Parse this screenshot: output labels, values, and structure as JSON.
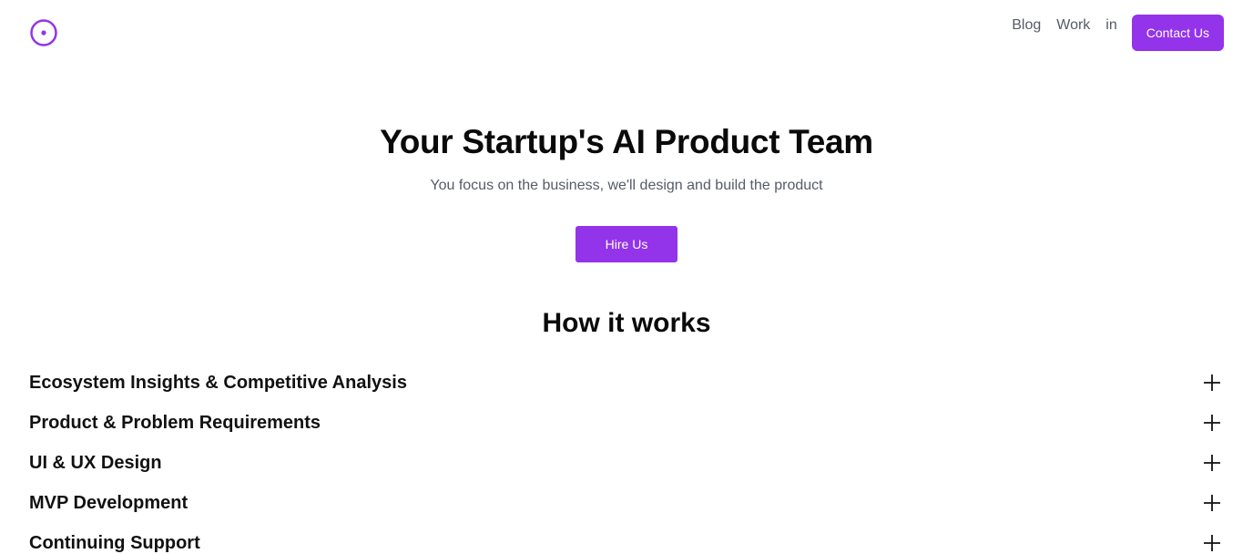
{
  "brand": {
    "logo_icon": "circle-dot-icon",
    "accent_color": "#9333ea"
  },
  "nav": {
    "blog": "Blog",
    "work": "Work",
    "linkedin": "in",
    "contact_button": "Contact Us"
  },
  "hero": {
    "title": "Your Startup's AI Product Team",
    "subtitle": "You focus on the business, we'll design and build the product",
    "cta_button": "Hire Us"
  },
  "how_it_works": {
    "title": "How it works",
    "items": [
      {
        "label": "Ecosystem Insights & Competitive Analysis",
        "icon": "plus-icon"
      },
      {
        "label": "Product & Problem Requirements",
        "icon": "plus-icon"
      },
      {
        "label": "UI & UX Design",
        "icon": "plus-icon"
      },
      {
        "label": "MVP Development",
        "icon": "plus-icon"
      },
      {
        "label": "Continuing Support",
        "icon": "plus-icon"
      }
    ]
  }
}
